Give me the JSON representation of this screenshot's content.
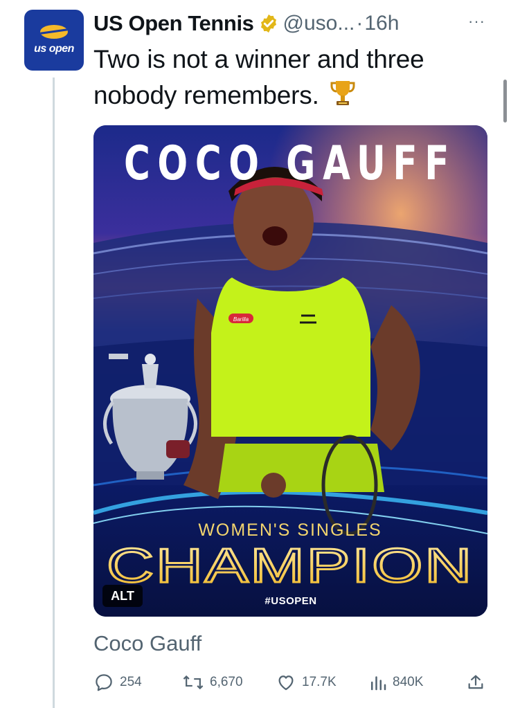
{
  "author": {
    "name": "US Open Tennis",
    "handle": "@uso...",
    "separator": "·",
    "time": "16h",
    "avatar_text": "us open",
    "more_label": "···"
  },
  "tweet": {
    "text": "Two is not a winner and three nobody remembers.",
    "trophy_icon": "trophy-icon"
  },
  "media": {
    "title": "COCO GAUFF",
    "subtitle": "WOMEN'S SINGLES",
    "headline": "CHAMPION",
    "hashtag": "#USOPEN",
    "alt_label": "ALT",
    "shirt_logo": "Barilla"
  },
  "card": {
    "title": "Coco Gauff"
  },
  "actions": {
    "replies": "254",
    "retweets": "6,670",
    "likes": "17.7K",
    "views": "840K"
  },
  "colors": {
    "text": "#0f1419",
    "muted": "#536471",
    "verified_gold": "#e2b719",
    "avatar_blue": "#1a3b9e",
    "champion_gold": "#f7d24b"
  }
}
